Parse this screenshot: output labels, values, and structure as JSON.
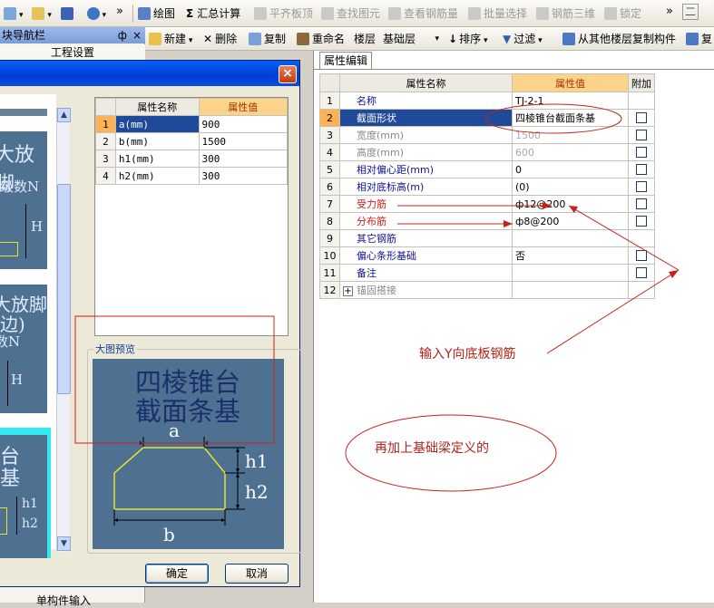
{
  "toolbar": {
    "items": [
      {
        "icon": "draw-icon",
        "label": "绘图",
        "disabled": false
      },
      {
        "icon": "sigma-icon",
        "label": "汇总计算",
        "disabled": false
      },
      {
        "icon": "align-slab-icon",
        "label": "平齐板顶",
        "disabled": true
      },
      {
        "icon": "find-element-icon",
        "label": "查找图元",
        "disabled": true
      },
      {
        "icon": "view-rebar-icon",
        "label": "查看钢筋量",
        "disabled": true
      },
      {
        "icon": "batch-select-icon",
        "label": "批量选择",
        "disabled": true
      },
      {
        "icon": "rebar-3d-icon",
        "label": "钢筋三维",
        "disabled": true
      },
      {
        "icon": "lock-icon",
        "label": "锁定",
        "disabled": true
      }
    ],
    "overflow": "»",
    "right_label": "二"
  },
  "toolbar2": {
    "new_label": "新建",
    "delete_label": "删除",
    "copy_label": "复制",
    "rename_label": "重命名",
    "floor_label": "楼层",
    "floor_value": "基础层",
    "sort_label": "排序",
    "filter_label": "过滤",
    "copy_from_label": "从其他楼层复制构件",
    "copy_to_label": "复"
  },
  "nav": {
    "title": "块导航栏",
    "pin": "ф",
    "close": "×",
    "sub": "工程设置",
    "bottom": "单构件输入"
  },
  "panel": {
    "tab": "属性编辑",
    "headers": {
      "name": "属性名称",
      "value": "属性值",
      "extra": "附加"
    },
    "rows": [
      {
        "n": "1",
        "name": "名称",
        "value": "TJ-2-1",
        "check": false,
        "gray": false
      },
      {
        "n": "2",
        "name": "截面形状",
        "value": "四棱锥台截面条基",
        "check": true,
        "gray": false,
        "selected": true
      },
      {
        "n": "3",
        "name": "宽度(mm)",
        "value": "1500",
        "check": true,
        "gray": true
      },
      {
        "n": "4",
        "name": "高度(mm)",
        "value": "600",
        "check": true,
        "gray": true
      },
      {
        "n": "5",
        "name": "相对偏心距(mm)",
        "value": "0",
        "check": true,
        "gray": false
      },
      {
        "n": "6",
        "name": "相对底标高(m)",
        "value": "(0)",
        "check": true,
        "gray": false
      },
      {
        "n": "7",
        "name": "受力筋",
        "value": "ф12@200",
        "check": true,
        "gray": false,
        "red": true
      },
      {
        "n": "8",
        "name": "分布筋",
        "value": "ф8@200",
        "check": true,
        "gray": false,
        "red": true
      },
      {
        "n": "9",
        "name": "其它钢筋",
        "value": "",
        "check": false,
        "gray": false
      },
      {
        "n": "10",
        "name": "偏心条形基础",
        "value": "否",
        "check": true,
        "gray": false
      },
      {
        "n": "11",
        "name": "备注",
        "value": "",
        "check": true,
        "gray": false
      },
      {
        "n": "12",
        "name": "锚固搭接",
        "value": "",
        "check": false,
        "gray": true,
        "expand": "+"
      }
    ]
  },
  "dialog": {
    "close": "×",
    "thumbs": [
      {
        "lines": [
          "大放脚"
        ],
        "extra": [
          "级数N",
          "H"
        ]
      },
      {
        "lines": [
          "大放脚",
          "边)"
        ],
        "extra": [
          "数N",
          "H"
        ]
      },
      {
        "lines": [
          "台",
          "基"
        ],
        "extra": [
          "h1",
          "h2"
        ]
      }
    ],
    "grid": {
      "headers": {
        "name": "属性名称",
        "value": "属性值"
      },
      "rows": [
        {
          "n": "1",
          "name": "a(mm)",
          "value": "900"
        },
        {
          "n": "2",
          "name": "b(mm)",
          "value": "1500"
        },
        {
          "n": "3",
          "name": "h1(mm)",
          "value": "300"
        },
        {
          "n": "4",
          "name": "h2(mm)",
          "value": "300"
        }
      ]
    },
    "preview_label": "大图预览",
    "preview": {
      "title_line1": "四棱锥台",
      "title_line2": "截面条基",
      "label_a": "a",
      "label_b": "b",
      "label_h1": "h1",
      "label_h2": "h2"
    },
    "ok": "确定",
    "cancel": "取消"
  },
  "annotations": {
    "rebar_note": "输入Y向底板钢筋",
    "beam_note": "再加上基础梁定义的"
  },
  "colors": {
    "annotation": "#c8201a",
    "selected_row": "#1f4a9a",
    "header_value_bg": "#fcd38a"
  }
}
